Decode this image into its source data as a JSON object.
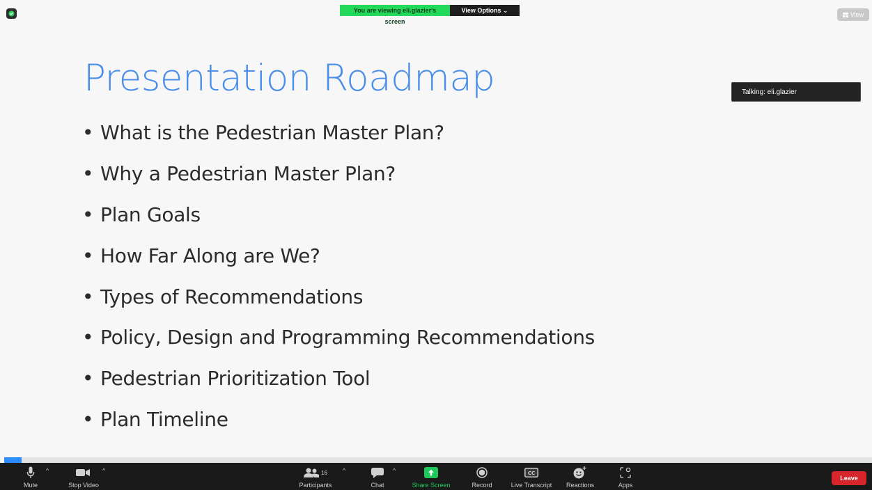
{
  "banner": {
    "viewing_text": "You are viewing eli.glazier's screen",
    "view_options_label": "View Options ⌄"
  },
  "view_button": {
    "label": "View"
  },
  "slide": {
    "title": "Presentation Roadmap",
    "bullet_glyph": "•",
    "bullets": [
      "What is the Pedestrian Master Plan?",
      "Why a Pedestrian Master Plan?",
      "Plan Goals",
      "How Far Along are We?",
      "Types of Recommendations",
      "Policy, Design and Programming Recommendations",
      "Pedestrian Prioritization Tool",
      "Plan Timeline"
    ]
  },
  "talking": {
    "label": "Talking: eli.glazier"
  },
  "progress": {
    "fraction": 0.02
  },
  "toolbar": {
    "mute": "Mute",
    "stop_video": "Stop Video",
    "participants": "Participants",
    "participants_count": "16",
    "chat": "Chat",
    "share_screen": "Share Screen",
    "record": "Record",
    "live_transcript": "Live Transcript",
    "reactions": "Reactions",
    "apps": "Apps",
    "leave": "Leave",
    "caret": "^"
  },
  "colors": {
    "title": "#4a8ee8",
    "share_screen": "#1ec95c",
    "leave": "#d6252b",
    "banner_green": "#23d95a"
  }
}
